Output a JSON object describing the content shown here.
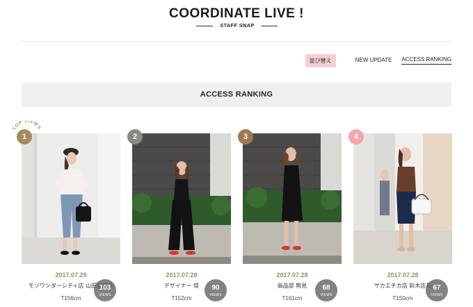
{
  "header": {
    "title": "COORDINATE LIVE !",
    "subtitle": "STAFF SNAP"
  },
  "sortbar": {
    "sort_label": "並び替え",
    "new_update": "NEW UPDATE",
    "access_ranking": "ACCESS RANKING"
  },
  "section": {
    "title": "ACCESS RANKING"
  },
  "badge": {
    "top_views": "TOP VIEWS"
  },
  "colors": {
    "rank1": "#a38b5a",
    "rank2": "#8a8a7e",
    "rank3": "#9c7a4c",
    "rank4": "#f2a6ad",
    "date": "#a08a5d",
    "sort_tag_bg": "#f6cfd2"
  },
  "snaps": [
    {
      "rank": "1",
      "views": "103",
      "views_label": "VIEWS",
      "date": "2017.07.29",
      "name": "モゾワンダーシティ店 山田副店長",
      "height": "T156cm"
    },
    {
      "rank": "2",
      "views": "90",
      "views_label": "VIEWS",
      "date": "2017.07.28",
      "name": "デザイナー 堤",
      "height": "T152cm"
    },
    {
      "rank": "3",
      "views": "68",
      "views_label": "VIEWS",
      "date": "2017.07.28",
      "name": "商品部 熊見",
      "height": "T161cm"
    },
    {
      "rank": "4",
      "views": "67",
      "views_label": "VIEWS",
      "date": "2017.07.28",
      "name": "サカエチカ店 鈴木店長",
      "height": "T150cm"
    }
  ]
}
